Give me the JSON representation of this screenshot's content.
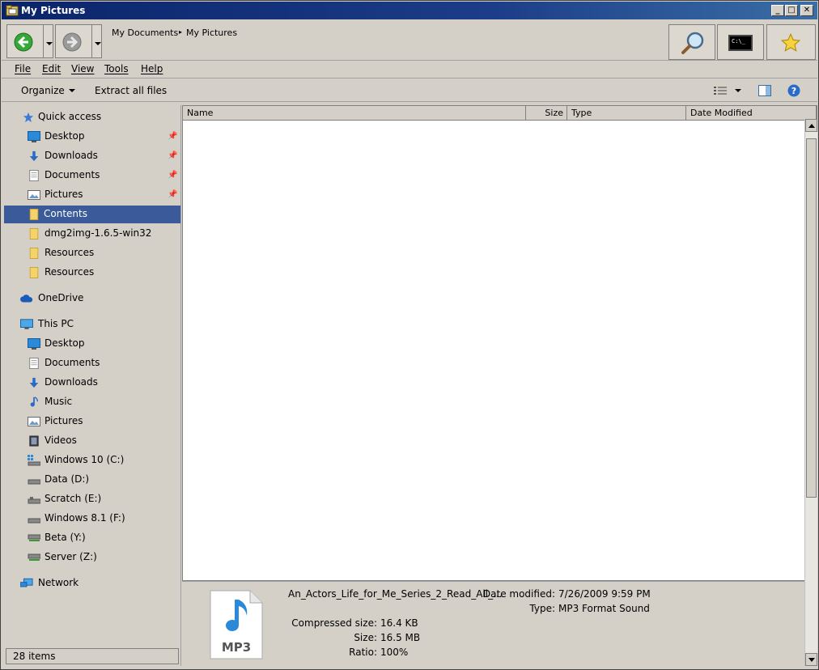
{
  "window": {
    "title": "My Pictures"
  },
  "navbar": {
    "breadcrumbs": [
      "My Documents",
      "My Pictures"
    ],
    "icons": {
      "back": "back-arrow-icon",
      "forward": "forward-arrow-icon",
      "search": "magnifier-icon",
      "console": "command-prompt-icon",
      "favorites": "star-icon"
    },
    "console_text": "C:\\_"
  },
  "menubar": {
    "items": [
      {
        "key": "F",
        "rest": "ile"
      },
      {
        "key": "E",
        "rest": "dit"
      },
      {
        "key": "V",
        "rest": "iew"
      },
      {
        "key": "T",
        "rest": "ools"
      },
      {
        "key": "H",
        "rest": "elp"
      }
    ]
  },
  "toolbar": {
    "organize": "Organize",
    "extract": "Extract all files"
  },
  "tree": {
    "quick_access": "Quick access",
    "quick_items": [
      "Desktop",
      "Downloads",
      "Documents",
      "Pictures"
    ],
    "folders": [
      "Contents",
      "dmg2img-1.6.5-win32",
      "Resources",
      "Resources"
    ],
    "onedrive": "OneDrive",
    "this_pc": "This PC",
    "pc_items": [
      "Desktop",
      "Documents",
      "Downloads",
      "Music",
      "Pictures",
      "Videos",
      "Windows 10 (C:)",
      "Data (D:)",
      "Scratch (E:)",
      "Windows 8.1 (F:)",
      "Beta (Y:)",
      "Server (Z:)"
    ],
    "network": "Network"
  },
  "status": {
    "count": "28 items"
  },
  "columns": {
    "name": "Name",
    "size": "Size",
    "type": "Type",
    "date": "Date Modified"
  },
  "details": {
    "filename": "An_Actors_Life_for_Me_Series_2_Read_All_...",
    "icon_label": "MP3",
    "date_modified_label": "Date modified:",
    "date_modified": "7/26/2009 9:59 PM",
    "type_label": "Type:",
    "type": "MP3 Format Sound",
    "compressed_label": "Compressed size:",
    "compressed": "16.4 KB",
    "size_label": "Size:",
    "size": "16.5 MB",
    "ratio_label": "Ratio:",
    "ratio": "100%"
  },
  "colors": {
    "selection": "#3a5a9a",
    "title_bar": "#0a246a",
    "chrome": "#d4d0c8"
  }
}
